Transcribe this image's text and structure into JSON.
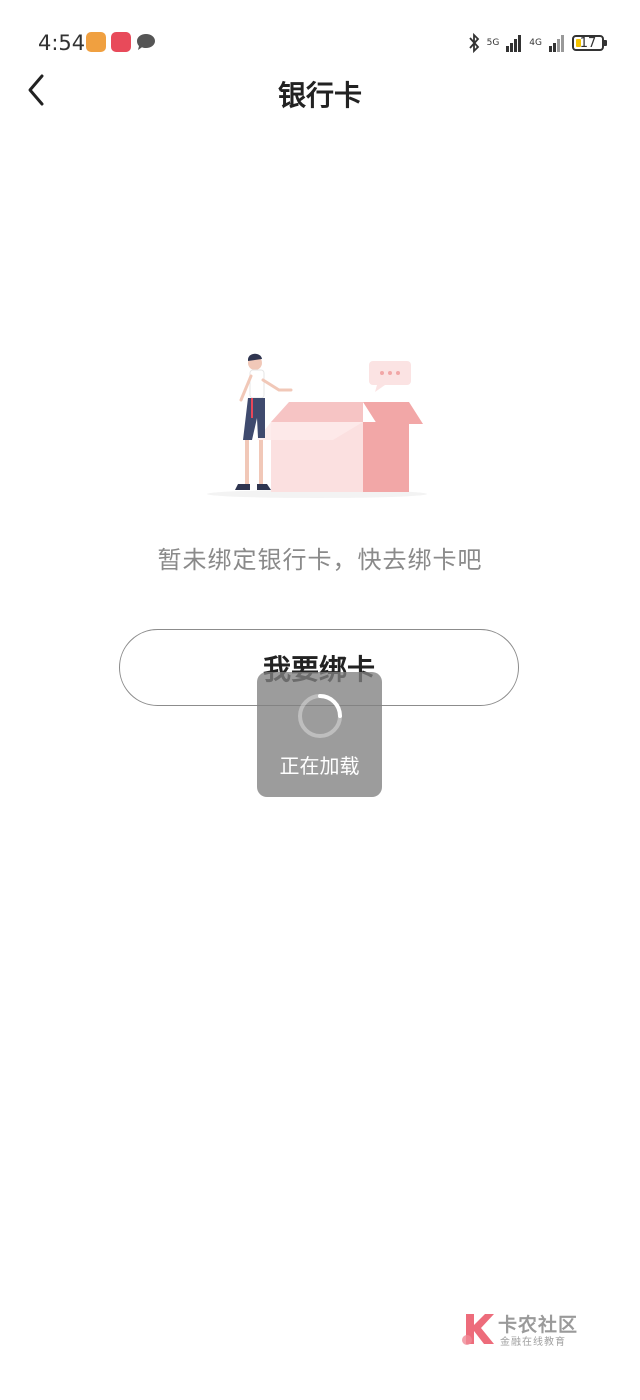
{
  "status_bar": {
    "time": "4:54",
    "network_1": "5G",
    "network_2": "4G",
    "battery": "17"
  },
  "header": {
    "title": "银行卡"
  },
  "empty_state": {
    "message": "暂未绑定银行卡，快去绑卡吧",
    "button_label": "我要绑卡"
  },
  "loading": {
    "text": "正在加载"
  },
  "watermark": {
    "title": "卡农社区",
    "subtitle": "金融在线教育"
  },
  "colors": {
    "box_pink": "#f2a7a7",
    "toast_bg": "#808080",
    "watermark_red": "#e8475a"
  }
}
